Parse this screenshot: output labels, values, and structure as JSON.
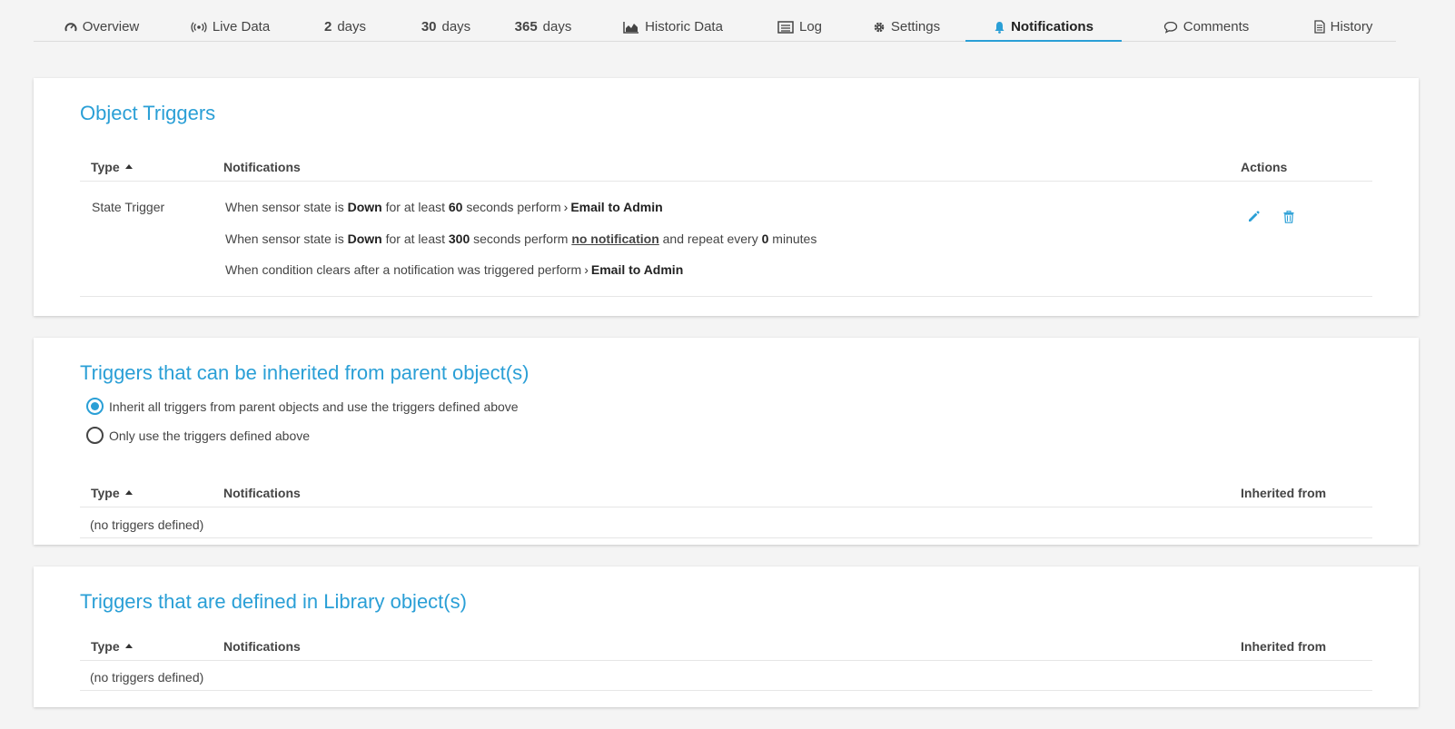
{
  "tabs": [
    {
      "label": "Overview",
      "icon": "gauge-icon"
    },
    {
      "label": "Live Data",
      "icon": "broadcast-icon"
    },
    {
      "num": "2",
      "label": "days"
    },
    {
      "num": "30",
      "label": "days"
    },
    {
      "num": "365",
      "label": "days"
    },
    {
      "label": "Historic Data",
      "icon": "area-chart-icon"
    },
    {
      "label": "Log",
      "icon": "list-icon"
    },
    {
      "label": "Settings",
      "icon": "gear-icon"
    },
    {
      "label": "Notifications",
      "icon": "bell-icon",
      "active": true
    },
    {
      "label": "Comments",
      "icon": "comment-icon"
    },
    {
      "label": "History",
      "icon": "document-icon"
    }
  ],
  "object_triggers": {
    "title": "Object Triggers",
    "columns": {
      "type": "Type",
      "notifications": "Notifications",
      "actions": "Actions"
    },
    "row": {
      "type": "State Trigger",
      "line1": {
        "a": "When sensor state is",
        "state": "Down",
        "b": "for at least",
        "secs": "60",
        "c": "seconds perform",
        "target": "Email to Admin"
      },
      "line2": {
        "a": "When sensor state is",
        "state": "Down",
        "b": "for at least",
        "secs": "300",
        "c": "seconds perform",
        "target": "no notification",
        "d": "and repeat every",
        "mins": "0",
        "e": "minutes"
      },
      "line3": {
        "a": "When condition clears after a notification was triggered perform",
        "target": "Email to Admin"
      }
    }
  },
  "inherited": {
    "title": "Triggers that can be inherited from parent object(s)",
    "options": [
      {
        "label": "Inherit all triggers from parent objects and use the triggers defined above",
        "checked": true
      },
      {
        "label": "Only use the triggers defined above",
        "checked": false
      }
    ],
    "columns": {
      "type": "Type",
      "notifications": "Notifications",
      "inherited_from": "Inherited from"
    },
    "empty": "(no triggers defined)"
  },
  "library": {
    "title": "Triggers that are defined in Library object(s)",
    "columns": {
      "type": "Type",
      "notifications": "Notifications",
      "inherited_from": "Inherited from"
    },
    "empty": "(no triggers defined)"
  },
  "colors": {
    "accent": "#2a9fd6"
  }
}
